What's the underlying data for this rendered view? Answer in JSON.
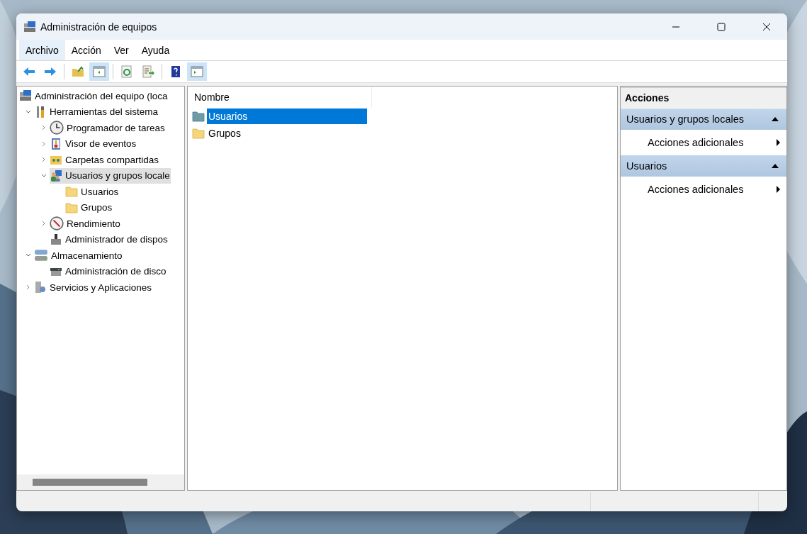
{
  "window": {
    "title": "Administración de equipos"
  },
  "menu": [
    {
      "label": "Archivo",
      "selected": true
    },
    {
      "label": "Acción",
      "selected": false
    },
    {
      "label": "Ver",
      "selected": false
    },
    {
      "label": "Ayuda",
      "selected": false
    }
  ],
  "toolbar": [
    {
      "kind": "back",
      "on": false
    },
    {
      "kind": "forward",
      "on": false
    },
    {
      "kind": "sep"
    },
    {
      "kind": "up",
      "on": false
    },
    {
      "kind": "tree",
      "on": true
    },
    {
      "kind": "sep"
    },
    {
      "kind": "refresh",
      "on": false
    },
    {
      "kind": "export",
      "on": false
    },
    {
      "kind": "sep"
    },
    {
      "kind": "help",
      "on": false
    },
    {
      "kind": "pane",
      "on": true
    }
  ],
  "tree": [
    {
      "label": "Administración del equipo (loca",
      "kind": "computer",
      "selected": false,
      "children": [
        {
          "label": "Herramientas del sistema",
          "kind": "tools",
          "selected": false,
          "expanded": true,
          "children": [
            {
              "label": "Programador de tareas",
              "kind": "clock",
              "selected": false,
              "expanded": false
            },
            {
              "label": "Visor de eventos",
              "kind": "log",
              "selected": false,
              "expanded": false
            },
            {
              "label": "Carpetas compartidas",
              "kind": "share",
              "selected": false,
              "expanded": false
            },
            {
              "label": "Usuarios y grupos locale",
              "kind": "users",
              "selected": true,
              "expanded": true,
              "children": [
                {
                  "label": "Usuarios",
                  "kind": "folder",
                  "selected": false
                },
                {
                  "label": "Grupos",
                  "kind": "folder",
                  "selected": false
                }
              ]
            },
            {
              "label": "Rendimiento",
              "kind": "gauge",
              "selected": false,
              "expanded": false
            },
            {
              "label": "Administrador de dispos",
              "kind": "device",
              "selected": false
            }
          ]
        },
        {
          "label": "Almacenamiento",
          "kind": "storage",
          "selected": false,
          "expanded": true,
          "children": [
            {
              "label": "Administración de disco",
              "kind": "disk",
              "selected": false
            }
          ]
        },
        {
          "label": "Servicios y Aplicaciones",
          "kind": "services",
          "selected": false,
          "expanded": false
        }
      ]
    }
  ],
  "list": {
    "columns": [
      "Nombre"
    ],
    "rows": [
      {
        "name": "Usuarios",
        "selected": true
      },
      {
        "name": "Grupos",
        "selected": false
      }
    ]
  },
  "actions": {
    "title": "Acciones",
    "sections": [
      {
        "title": "Usuarios y grupos locales",
        "expanded": true,
        "items": [
          "Acciones adicionales"
        ]
      },
      {
        "title": "Usuarios",
        "expanded": true,
        "items": [
          "Acciones adicionales"
        ]
      }
    ]
  }
}
